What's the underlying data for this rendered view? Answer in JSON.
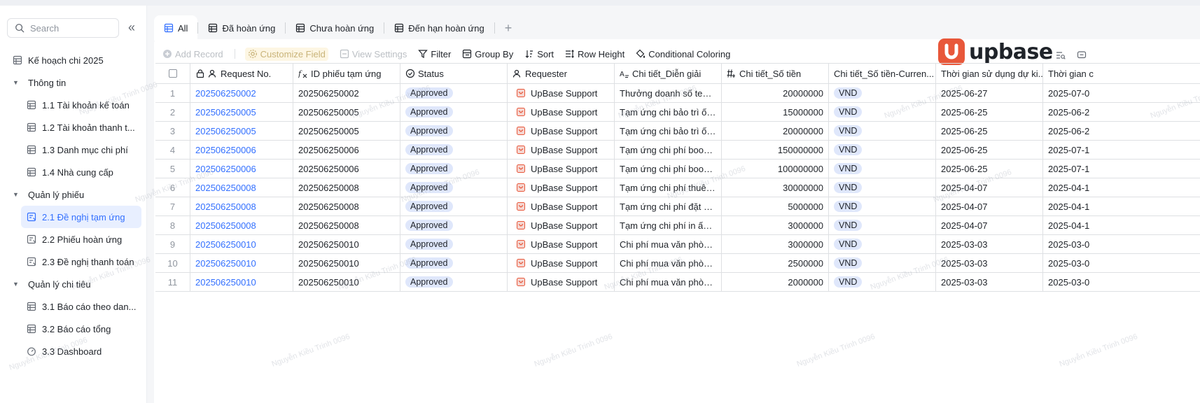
{
  "sidebar": {
    "search_placeholder": "Search",
    "collapse_glyph": "«",
    "items": [
      {
        "type": "top",
        "label": "Kế hoạch chi 2025",
        "icon": "table-icon"
      },
      {
        "type": "group",
        "label": "Thông tin"
      },
      {
        "type": "child",
        "label": "1.1 Tài khoản kế toán",
        "icon": "table-icon"
      },
      {
        "type": "child",
        "label": "1.2 Tài khoản thanh t...",
        "icon": "table-icon"
      },
      {
        "type": "child",
        "label": "1.3 Danh mục chi phí",
        "icon": "table-icon"
      },
      {
        "type": "child",
        "label": "1.4 Nhà cung cấp",
        "icon": "table-icon"
      },
      {
        "type": "group",
        "label": "Quản lý phiếu"
      },
      {
        "type": "child",
        "label": "2.1 Đề nghị tạm ứng",
        "icon": "form-icon",
        "active": true
      },
      {
        "type": "child",
        "label": "2.2 Phiếu hoàn ứng",
        "icon": "form-icon"
      },
      {
        "type": "child",
        "label": "2.3 Đề nghị thanh toán",
        "icon": "form-icon"
      },
      {
        "type": "group",
        "label": "Quản lý chi tiêu"
      },
      {
        "type": "child",
        "label": "3.1 Báo cáo theo dan...",
        "icon": "table-icon"
      },
      {
        "type": "child",
        "label": "3.2 Báo cáo tổng",
        "icon": "table-icon"
      },
      {
        "type": "child",
        "label": "3.3 Dashboard",
        "icon": "dashboard-icon"
      }
    ]
  },
  "tabs": [
    {
      "label": "All",
      "active": true
    },
    {
      "label": "Đã hoàn ứng"
    },
    {
      "label": "Chưa hoàn ứng"
    },
    {
      "label": "Đến hạn hoàn ứng"
    }
  ],
  "tab_add": "+",
  "toolbar": {
    "add_record": "Add Record",
    "customize_field": "Customize Field",
    "view_settings": "View Settings",
    "filter": "Filter",
    "group_by": "Group By",
    "sort": "Sort",
    "row_height": "Row Height",
    "conditional_coloring": "Conditional Coloring"
  },
  "logo": {
    "text": "upbase",
    "color": "#e8573a"
  },
  "columns": [
    "Request No.",
    "ID phiếu tạm ứng",
    "Status",
    "Requester",
    "Chi tiết_Diễn giải",
    "Chi tiết_Số tiền",
    "Chi tiết_Số tiền-Curren...",
    "Thời gian sử dụng dự ki...",
    "Thời gian c"
  ],
  "rows": [
    {
      "n": "1",
      "req": "202506250002",
      "id": "202506250002",
      "status": "Approved",
      "requester": "UpBase Support",
      "desc": "Thưởng doanh số team...",
      "amount": "20000000",
      "currency": "VND",
      "start": "2025-06-27",
      "end": "2025-07-0"
    },
    {
      "n": "2",
      "req": "202506250005",
      "id": "202506250005",
      "status": "Approved",
      "requester": "UpBase Support",
      "desc": "Tạm ứng chi bảo trì ống...",
      "amount": "15000000",
      "currency": "VND",
      "start": "2025-06-25",
      "end": "2025-06-2"
    },
    {
      "n": "3",
      "req": "202506250005",
      "id": "202506250005",
      "status": "Approved",
      "requester": "UpBase Support",
      "desc": "Tạm ứng chi bảo trì ống...",
      "amount": "20000000",
      "currency": "VND",
      "start": "2025-06-25",
      "end": "2025-06-2"
    },
    {
      "n": "4",
      "req": "202506250006",
      "id": "202506250006",
      "status": "Approved",
      "requester": "UpBase Support",
      "desc": "Tạm ứng chi phí book K...",
      "amount": "150000000",
      "currency": "VND",
      "start": "2025-06-25",
      "end": "2025-07-1"
    },
    {
      "n": "5",
      "req": "202506250006",
      "id": "202506250006",
      "status": "Approved",
      "requester": "UpBase Support",
      "desc": "Tạm ứng chi phí book a...",
      "amount": "100000000",
      "currency": "VND",
      "start": "2025-06-25",
      "end": "2025-07-1"
    },
    {
      "n": "6",
      "req": "202506250008",
      "id": "202506250008",
      "status": "Approved",
      "requester": "UpBase Support",
      "desc": "Tạm ứng chi phí thuê k...",
      "amount": "30000000",
      "currency": "VND",
      "start": "2025-04-07",
      "end": "2025-04-1"
    },
    {
      "n": "7",
      "req": "202506250008",
      "id": "202506250008",
      "status": "Approved",
      "requester": "UpBase Support",
      "desc": "Tạm ứng chi phí đặt de...",
      "amount": "5000000",
      "currency": "VND",
      "start": "2025-04-07",
      "end": "2025-04-1"
    },
    {
      "n": "8",
      "req": "202506250008",
      "id": "202506250008",
      "status": "Approved",
      "requester": "UpBase Support",
      "desc": "Tạm ứng chi phí in ấn b...",
      "amount": "3000000",
      "currency": "VND",
      "start": "2025-04-07",
      "end": "2025-04-1"
    },
    {
      "n": "9",
      "req": "202506250010",
      "id": "202506250010",
      "status": "Approved",
      "requester": "UpBase Support",
      "desc": "Chi phí mua văn phòng ...",
      "amount": "3000000",
      "currency": "VND",
      "start": "2025-03-03",
      "end": "2025-03-0"
    },
    {
      "n": "10",
      "req": "202506250010",
      "id": "202506250010",
      "status": "Approved",
      "requester": "UpBase Support",
      "desc": "Chi phí mua văn phòng ...",
      "amount": "2500000",
      "currency": "VND",
      "start": "2025-03-03",
      "end": "2025-03-0"
    },
    {
      "n": "11",
      "req": "202506250010",
      "id": "202506250010",
      "status": "Approved",
      "requester": "UpBase Support",
      "desc": "Chi phí mua văn phòng ...",
      "amount": "2000000",
      "currency": "VND",
      "start": "2025-03-03",
      "end": "2025-03-0"
    }
  ],
  "watermark_text": "Nguyễn Kiều Trinh 0096",
  "colors": {
    "accent": "#3370ff",
    "badge": "#dfe7fb",
    "brand": "#e8573a"
  }
}
